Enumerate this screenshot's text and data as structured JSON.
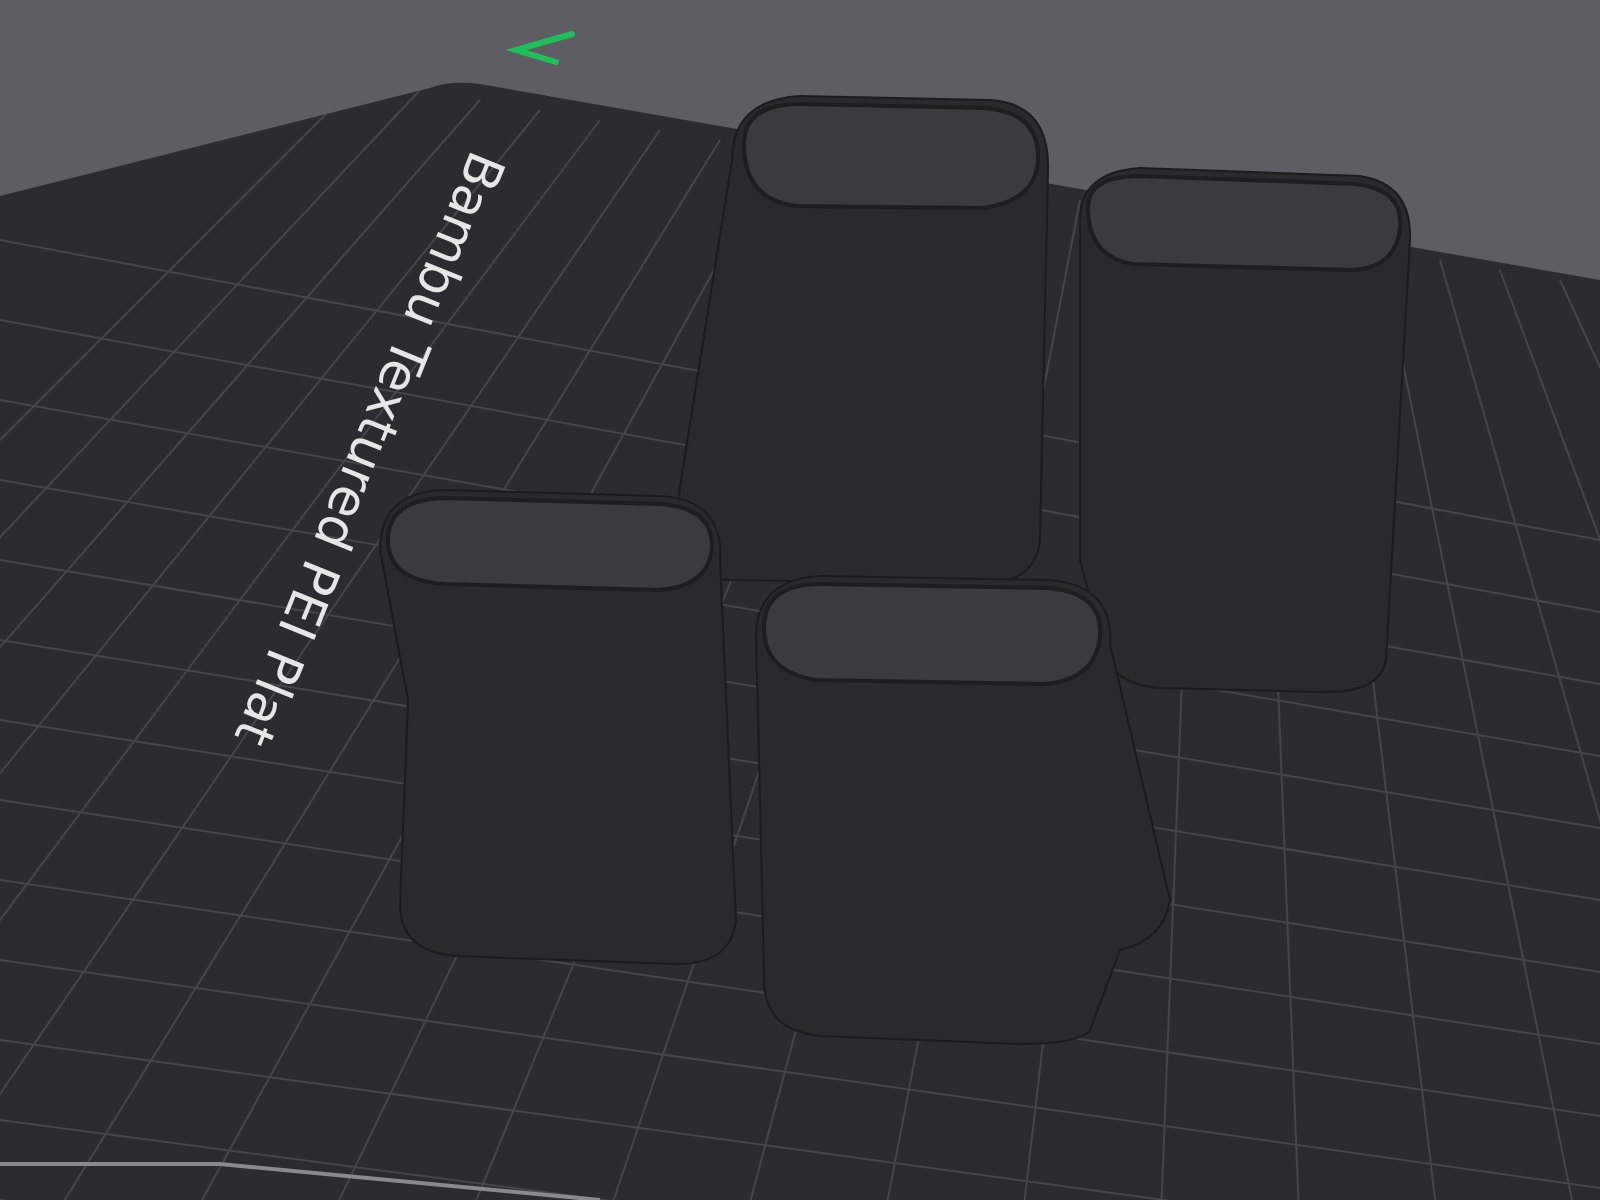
{
  "viewport": {
    "plate_label": "Bambu Textured PEI Plat"
  }
}
